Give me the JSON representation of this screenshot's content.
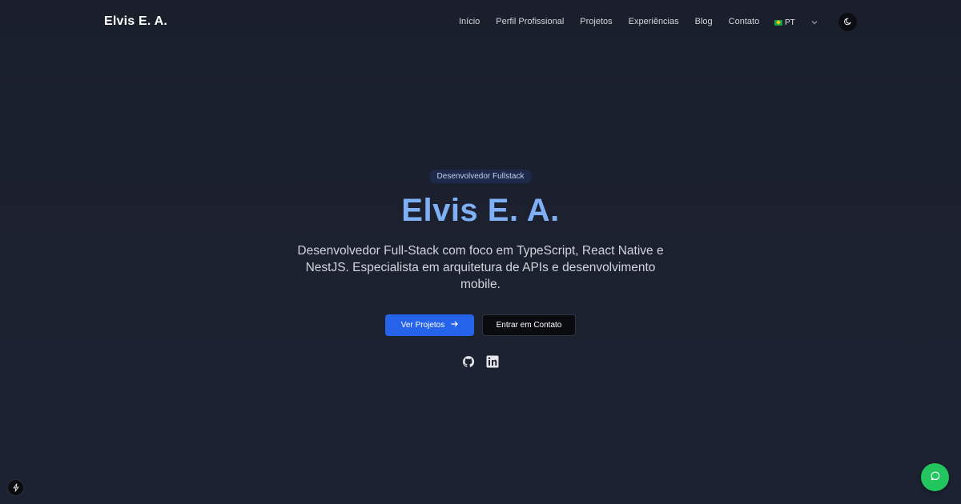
{
  "header": {
    "brand": "Elvis E. A.",
    "nav": [
      "Início",
      "Perfil Profissional",
      "Projetos",
      "Experiências",
      "Blog",
      "Contato"
    ],
    "language": "PT",
    "language_icon": "brazil-flag-icon",
    "theme_icon": "moon-icon"
  },
  "hero": {
    "badge": "Desenvolvedor Fullstack",
    "title": "Elvis E. A.",
    "description": "Desenvolvedor Full-Stack com foco em TypeScript, React Native e NestJS. Especialista em arquitetura de APIs e desenvolvimento mobile.",
    "primary_button": "Ver Projetos",
    "secondary_button": "Entrar em Contato",
    "socials": [
      "github-icon",
      "linkedin-icon"
    ]
  },
  "colors": {
    "background": "#1b202d",
    "accent": "#2563eb",
    "title": "#7fb0f5",
    "chat": "#22c55e"
  }
}
